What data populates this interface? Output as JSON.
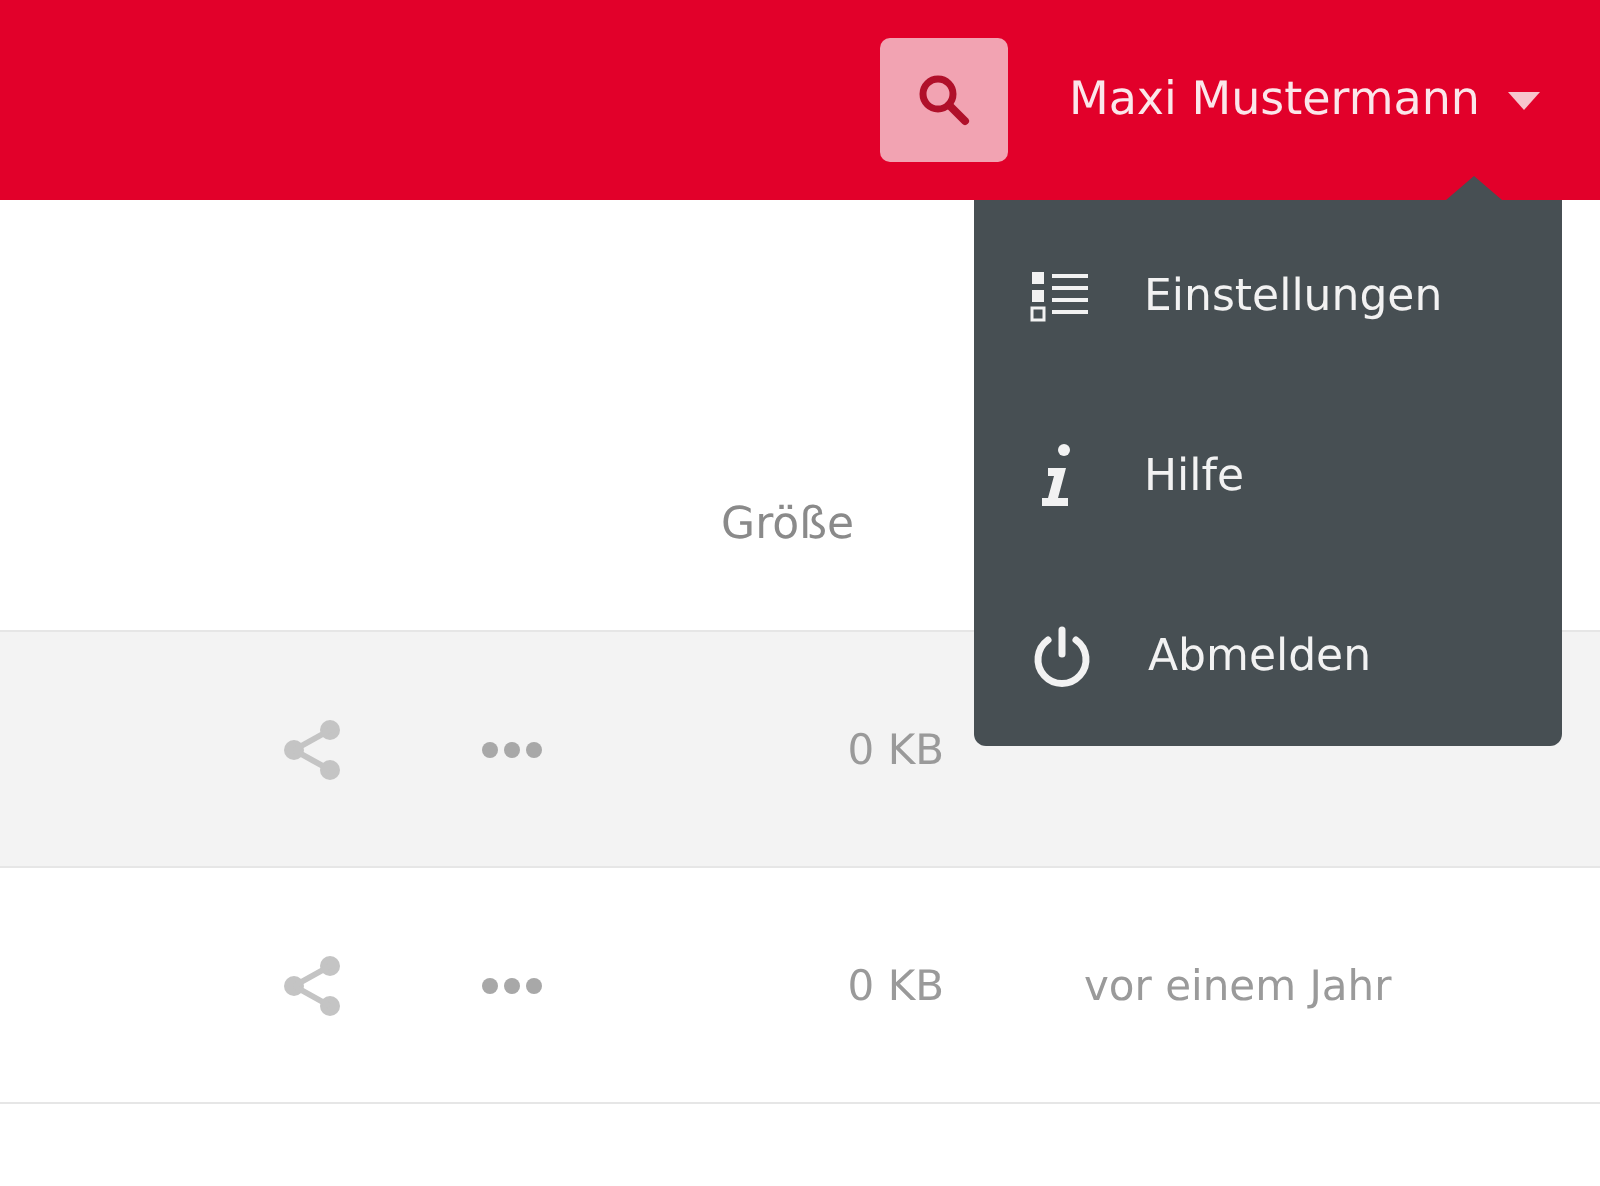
{
  "header": {
    "user_name": "Maxi Mustermann",
    "menu_open": true
  },
  "user_menu": [
    {
      "kind": "settings",
      "label": "Einstellungen"
    },
    {
      "kind": "help",
      "label": "Hilfe"
    },
    {
      "kind": "logout",
      "label": "Abmelden"
    }
  ],
  "table": {
    "columns": [
      {
        "label": "Größe"
      }
    ],
    "rows": [
      {
        "size": "0 KB",
        "hovered": true
      },
      {
        "size": "0 KB",
        "modified": "vor einem Jahr",
        "hovered": false
      }
    ]
  }
}
